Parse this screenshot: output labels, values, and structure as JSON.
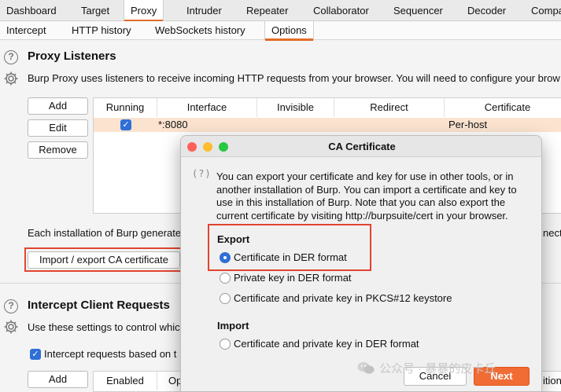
{
  "top_tabs": [
    "Dashboard",
    "Target",
    "Proxy",
    "Intruder",
    "Repeater",
    "Collaborator",
    "Sequencer",
    "Decoder",
    "Compa"
  ],
  "sub_tabs": [
    "Intercept",
    "HTTP history",
    "WebSockets history",
    "Options"
  ],
  "proxy_listeners": {
    "title": "Proxy Listeners",
    "description": "Burp Proxy uses listeners to receive incoming HTTP requests from your browser. You will need to configure your brow",
    "buttons": {
      "add": "Add",
      "edit": "Edit",
      "remove": "Remove"
    },
    "columns": [
      "Running",
      "Interface",
      "Invisible",
      "Redirect",
      "Certificate"
    ],
    "rows": [
      {
        "running": true,
        "interface": "*:8080",
        "invisible": "",
        "redirect": "",
        "certificate": "Per-host"
      }
    ],
    "cert_text": "Each installation of Burp generate",
    "cert_text_right": "necti",
    "import_export_button": "Import / export CA certificate"
  },
  "intercept_client": {
    "title": "Intercept Client Requests",
    "description": "Use these settings to control whic",
    "checkbox_label": "Intercept requests based on t",
    "buttons": {
      "add": "Add"
    },
    "columns": [
      "Enabled",
      "Op"
    ],
    "right_text": "ition"
  },
  "dialog": {
    "title": "CA Certificate",
    "help_glyph": "?",
    "description_lines": [
      "You can export your certificate and key for use in other tools, or in",
      "another installation of Burp. You can import a certificate and key to",
      "use in this installation of Burp. Note that you can also export the",
      "current certificate by visiting http://burpsuite/cert in your browser."
    ],
    "export_label": "Export",
    "export_options": [
      "Certificate in DER format",
      "Private key in DER format",
      "Certificate and private key in PKCS#12 keystore"
    ],
    "export_selected_index": 0,
    "import_label": "Import",
    "import_options": [
      "Certificate and private key in DER format"
    ],
    "cancel_label": "Cancel",
    "next_label": "Next"
  },
  "watermark": "公众号 · 暴暴的皮卡丘",
  "colors": {
    "accent_orange": "#e36c25",
    "highlight_red": "#e2442f",
    "selected_row": "#fbe3cf",
    "checkbox_blue": "#2f6fd6"
  }
}
